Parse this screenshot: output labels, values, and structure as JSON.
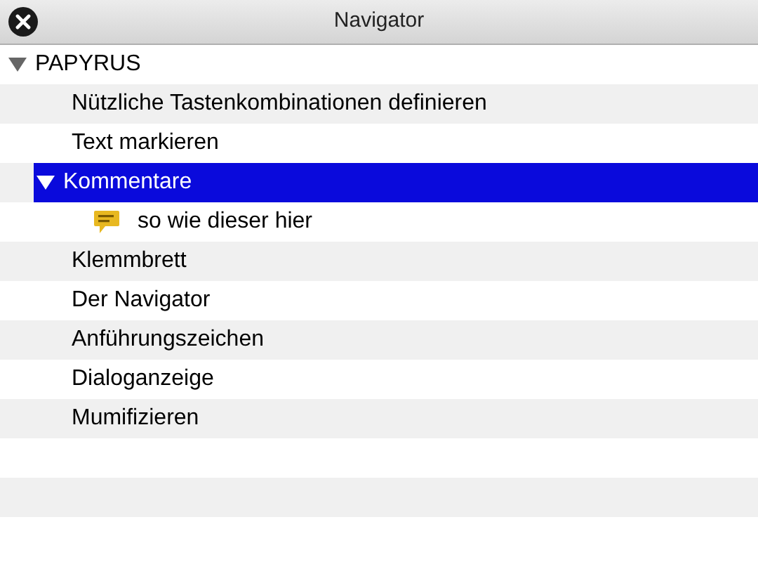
{
  "window": {
    "title": "Navigator"
  },
  "tree": [
    {
      "label": "PAPYRUS",
      "expanded": true,
      "selected": false,
      "children": [
        {
          "label": "Nützliche Tastenkombinationen definieren",
          "selected": false
        },
        {
          "label": "Text markieren",
          "selected": false
        },
        {
          "label": "Kommentare",
          "expanded": true,
          "selected": true,
          "children": [
            {
              "label": "so wie dieser hier",
              "kind": "comment",
              "selected": false
            }
          ]
        },
        {
          "label": "Klemmbrett",
          "selected": false
        },
        {
          "label": "Der Navigator",
          "selected": false
        },
        {
          "label": "Anführungszeichen",
          "selected": false
        },
        {
          "label": "Dialoganzeige",
          "selected": false
        },
        {
          "label": "Mumifizieren",
          "selected": false
        }
      ]
    }
  ]
}
